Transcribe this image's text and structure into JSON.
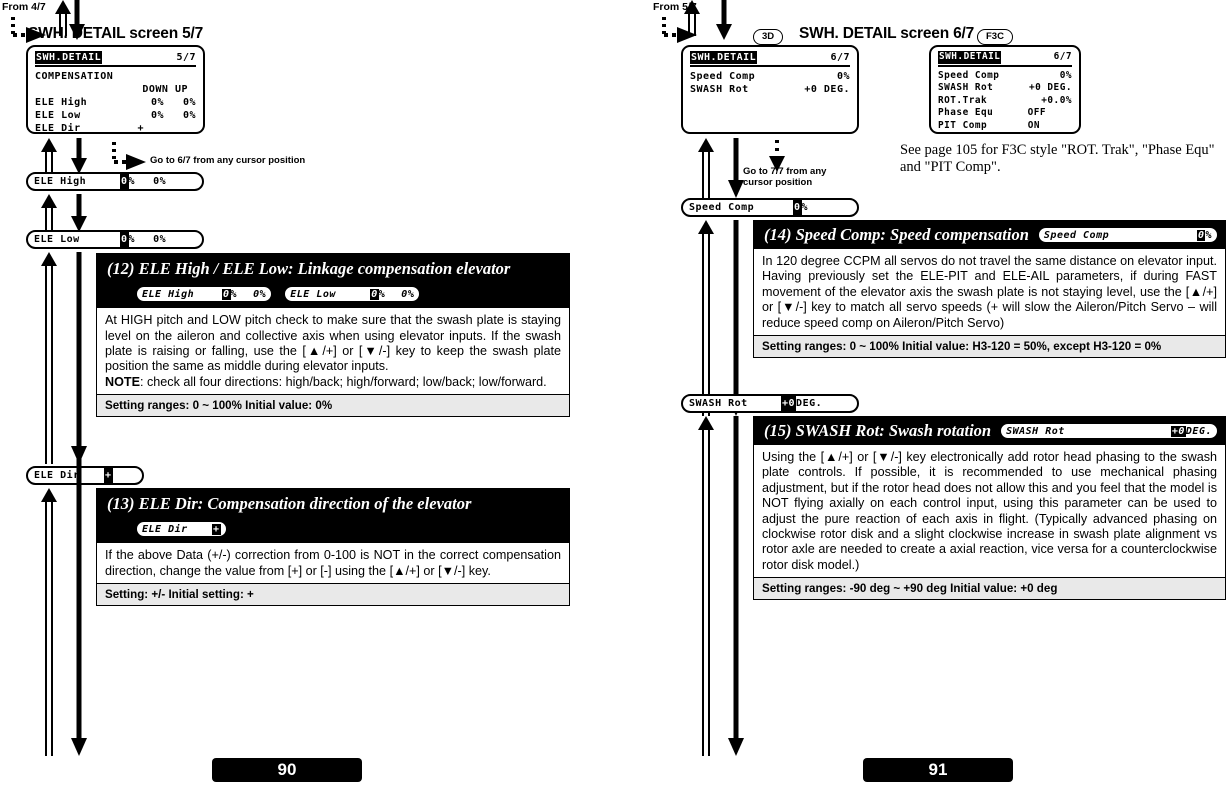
{
  "pages": [
    {
      "id": "page-90",
      "page_number": "90",
      "entry_label": "From 4/7",
      "screen_title": "SWH. DETAIL screen 5/7",
      "goto_label": "Go to 6/7 from any cursor position",
      "lcd": {
        "title": "SWH.DETAIL",
        "page_indicator": "5/7",
        "header": "COMPENSATION",
        "col_headers": "DOWN  UP",
        "rows": [
          {
            "label": "ELE High",
            "v1": "0%",
            "v2": "0%"
          },
          {
            "label": "ELE Low",
            "v1": "0%",
            "v2": "0%"
          },
          {
            "label": "ELE Dir",
            "v1": "+",
            "v2": ""
          }
        ]
      },
      "fields": [
        {
          "name": "ele-high",
          "label": "ELE High",
          "selected": "0",
          "unit": "%",
          "second": "0%"
        },
        {
          "name": "ele-low",
          "label": "ELE Low",
          "selected": "0",
          "unit": "%",
          "second": "0%"
        },
        {
          "name": "ele-dir",
          "label": "ELE Dir",
          "selected": "+",
          "unit": "",
          "second": ""
        }
      ],
      "sections": [
        {
          "id": "sec-12",
          "title": "(12) ELE High / ELE Low: Linkage compensation elevator",
          "inline_fields": [
            {
              "label": "ELE High",
              "selected": "0",
              "unit": "%",
              "second": "0%"
            },
            {
              "label": "ELE Low",
              "selected": "0",
              "unit": "%",
              "second": "0%"
            }
          ],
          "body": "At HIGH pitch and LOW pitch check to make sure that the swash plate is staying level on the aileron and collective axis when using elevator inputs. If the swash plate is raising or falling, use the [▲/+] or [▼/-] key to keep the swash plate position the same as middle during elevator inputs.",
          "note_label": "NOTE",
          "note_body": ": check all four directions: high/back; high/forward; low/back; low/forward.",
          "footer": "Setting ranges:  0 ~ 100%    Initial value: 0%"
        },
        {
          "id": "sec-13",
          "title": "(13) ELE Dir: Compensation direction of the elevator",
          "inline_fields": [
            {
              "label": "ELE Dir",
              "selected": "+",
              "unit": "",
              "second": ""
            }
          ],
          "body": "If the above Data (+/-) correction from 0-100 is NOT in the correct compensation direction, change the value from [+] or [-] using the [▲/+] or [▼/-] key.",
          "footer": "Setting:  +/-    Initial setting: +"
        }
      ]
    },
    {
      "id": "page-91",
      "page_number": "91",
      "entry_label": "From 5/7",
      "screen_title": "SWH. DETAIL screen 6/7",
      "badge_left": "3D",
      "badge_right": "F3C",
      "goto_label_line1": "Go to 7/7 from any",
      "goto_label_line2": "cursor position",
      "f3c_note": "See page 105 for F3C style \"ROT. Trak\", \"Phase Equ\" and \"PIT Comp\".",
      "lcd_3d": {
        "title": "SWH.DETAIL",
        "page_indicator": "6/7",
        "rows": [
          {
            "label": "Speed Comp",
            "value": "0%"
          },
          {
            "label": "SWASH Rot",
            "value": "+0 DEG."
          }
        ]
      },
      "lcd_f3c": {
        "title": "SWH.DETAIL",
        "page_indicator": "6/7",
        "rows": [
          {
            "label": "Speed Comp",
            "value": "0%"
          },
          {
            "label": "SWASH Rot",
            "value": "+0 DEG."
          },
          {
            "label": "ROT.Trak",
            "value": "+0.0%"
          },
          {
            "label": "Phase Equ",
            "value": "OFF"
          },
          {
            "label": "PIT Comp",
            "value": "ON"
          }
        ]
      },
      "fields": [
        {
          "name": "speed-comp",
          "label": "Speed Comp",
          "selected": "0",
          "unit": "%",
          "second": ""
        },
        {
          "name": "swash-rot",
          "label": "SWASH Rot",
          "selected": "+0",
          "unit": "DEG.",
          "second": ""
        }
      ],
      "sections": [
        {
          "id": "sec-14",
          "title": "(14) Speed Comp: Speed compensation",
          "inline_fields": [
            {
              "label": "Speed Comp",
              "selected": "0",
              "unit": "%",
              "second": ""
            }
          ],
          "body": "In 120 degree CCPM all servos do not travel the same distance on elevator input. Having previously set the ELE-PIT and ELE-AIL parameters, if during FAST movement of the elevator axis the swash plate is not staying level, use the [▲/+] or [▼/-] key to match all servo speeds (+ will slow the Aileron/Pitch Servo – will reduce speed comp on Aileron/Pitch Servo)",
          "footer": "Setting ranges:  0 ~ 100%    Initial value: H3-120 = 50%, except H3-120 = 0%"
        },
        {
          "id": "sec-15",
          "title": "(15) SWASH Rot: Swash rotation",
          "inline_fields": [
            {
              "label": "SWASH Rot",
              "selected": "+0",
              "unit": "DEG.",
              "second": ""
            }
          ],
          "body": "Using the [▲/+] or [▼/-] key electronically add rotor head phasing to the swash plate controls. If possible, it is recommended to use mechanical phasing adjustment, but if the rotor head does not allow this and you feel that the model is NOT flying axially on each control input, using this parameter can be used to adjust the pure reaction of each axis in flight. (Typically advanced phasing on clockwise rotor disk and a slight clockwise increase in swash plate alignment vs rotor axle are needed to create a axial reaction, vice versa for a counterclockwise rotor disk model.)",
          "footer": "Setting ranges:  -90 deg ~ +90 deg    Initial value:  +0 deg"
        }
      ]
    }
  ]
}
